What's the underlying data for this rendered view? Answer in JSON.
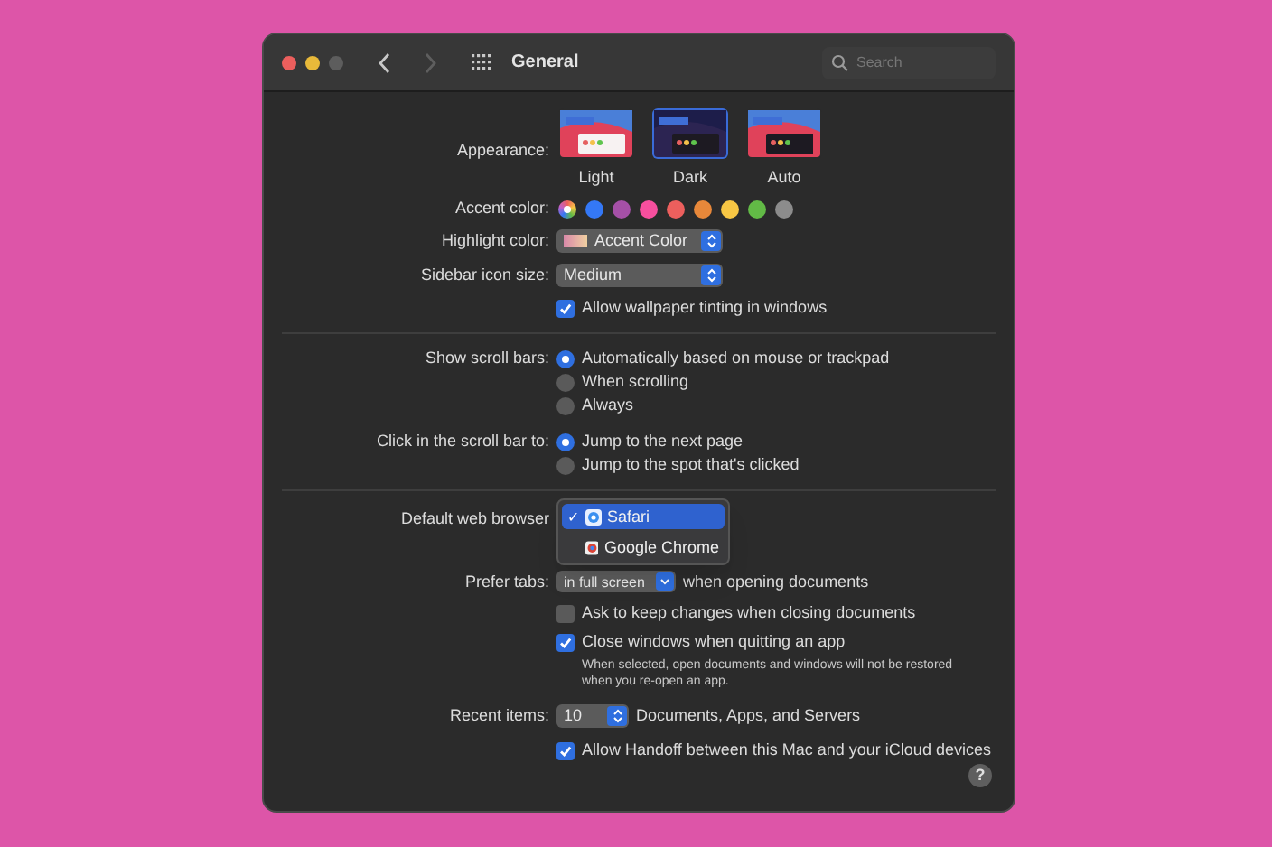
{
  "window": {
    "title": "General",
    "search": {
      "placeholder": "Search"
    }
  },
  "appearance": {
    "label": "Appearance:",
    "options": [
      {
        "name": "Light",
        "selected": false
      },
      {
        "name": "Dark",
        "selected": true
      },
      {
        "name": "Auto",
        "selected": false
      }
    ]
  },
  "accent": {
    "label": "Accent color:",
    "colors": [
      {
        "kind": "multicolor",
        "selected": true
      },
      {
        "kind": "solid",
        "color": "#3478f6",
        "selected": false
      },
      {
        "kind": "solid",
        "color": "#a550a7",
        "selected": false
      },
      {
        "kind": "solid",
        "color": "#f74f9e",
        "selected": false
      },
      {
        "kind": "solid",
        "color": "#ec5f5d",
        "selected": false
      },
      {
        "kind": "solid",
        "color": "#e8883a",
        "selected": false
      },
      {
        "kind": "solid",
        "color": "#f8c744",
        "selected": false
      },
      {
        "kind": "solid",
        "color": "#62ba46",
        "selected": false
      },
      {
        "kind": "solid",
        "color": "#8c8c8c",
        "selected": false
      }
    ]
  },
  "highlight": {
    "label": "Highlight color:",
    "value": "Accent Color"
  },
  "sidebar_icon_size": {
    "label": "Sidebar icon size:",
    "value": "Medium"
  },
  "wallpaper_tinting": {
    "label": "Allow wallpaper tinting in windows",
    "checked": true
  },
  "scroll_bars": {
    "label": "Show scroll bars:",
    "options": [
      {
        "label": "Automatically based on mouse or trackpad",
        "selected": true
      },
      {
        "label": "When scrolling",
        "selected": false
      },
      {
        "label": "Always",
        "selected": false
      }
    ]
  },
  "scroll_click": {
    "label": "Click in the scroll bar to:",
    "options": [
      {
        "label": "Jump to the next page",
        "selected": true
      },
      {
        "label": "Jump to the spot that's clicked",
        "selected": false
      }
    ]
  },
  "default_browser": {
    "label": "Default web browser",
    "check_mark": "✓",
    "menu": [
      {
        "label": "Safari",
        "selected": true
      },
      {
        "label": "Google Chrome",
        "selected": false
      }
    ]
  },
  "prefer_tabs": {
    "label": "Prefer tabs:",
    "value": "in full screen",
    "suffix": "when opening documents"
  },
  "checkboxes": [
    {
      "label": "Ask to keep changes when closing documents",
      "checked": false
    },
    {
      "label": "Close windows when quitting an app",
      "checked": true,
      "note": "When selected, open documents and windows will not be restored when you re-open an app."
    }
  ],
  "recent_items": {
    "label": "Recent items:",
    "value": "10",
    "suffix": "Documents, Apps, and Servers"
  },
  "handoff": {
    "label": "Allow Handoff between this Mac and your iCloud devices",
    "checked": true
  },
  "help": "?"
}
